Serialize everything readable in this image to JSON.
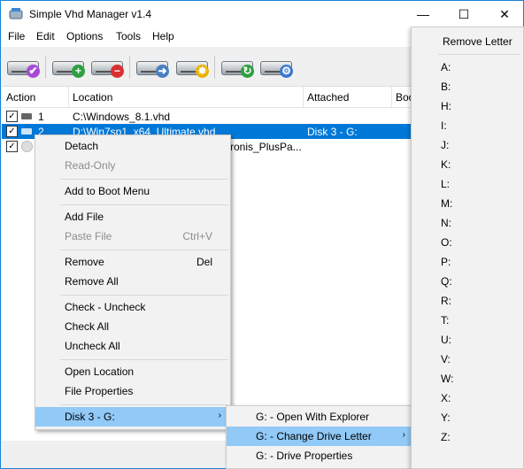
{
  "window": {
    "title": "Simple Vhd Manager v1.4",
    "minimize": "—",
    "maximize": "☐",
    "close": "✕"
  },
  "menubar": {
    "file": "File",
    "edit": "Edit",
    "options": "Options",
    "tools": "Tools",
    "help": "Help"
  },
  "toolbar": {
    "buttons": [
      {
        "name": "attach-button",
        "badge": "✔",
        "color": "#a64ad6"
      },
      {
        "name": "add-button",
        "badge": "+",
        "color": "#2ea043"
      },
      {
        "name": "remove-button",
        "badge": "−",
        "color": "#d93030"
      },
      {
        "name": "open-location-button",
        "badge": "➜",
        "color": "#4a7fc1"
      },
      {
        "name": "properties-button",
        "badge": "✸",
        "color": "#e8b400"
      },
      {
        "name": "refresh-button",
        "badge": "↻",
        "color": "#2ea043"
      },
      {
        "name": "settings-button",
        "badge": "⚙",
        "color": "#3a78d0"
      }
    ]
  },
  "list": {
    "columns": [
      "Action",
      "Location",
      "Attached",
      "Boo"
    ],
    "rows": [
      {
        "check": "✓",
        "num": "1",
        "location": "C:\\Windows_8.1.vhd",
        "attached": ""
      },
      {
        "check": "✓",
        "num": "2",
        "location": "D:\\Win7sp1_x64_Ultimate.vhd",
        "attached": "Disk 3  -  G:"
      },
      {
        "check": "✓",
        "num": "",
        "location": "ronis_PlusPa...",
        "attached": ""
      }
    ]
  },
  "context_menu": {
    "detach": "Detach",
    "read_only": "Read-Only",
    "add_boot": "Add to Boot Menu",
    "add_file": "Add File",
    "paste_file": "Paste File",
    "paste_shortcut": "Ctrl+V",
    "remove": "Remove",
    "remove_shortcut": "Del",
    "remove_all": "Remove All",
    "check_uncheck": "Check - Uncheck",
    "check_all": "Check All",
    "uncheck_all": "Uncheck All",
    "open_location": "Open Location",
    "file_properties": "File Properties",
    "disk": "Disk 3  -  G:",
    "arrow": "›"
  },
  "submenu": {
    "open_explorer": "G: - Open With Explorer",
    "change_letter": "G: - Change Drive Letter",
    "drive_properties": "G: - Drive Properties",
    "arrow": "›"
  },
  "letter_menu": {
    "title": "Remove Letter",
    "letters": [
      "A:",
      "B:",
      "H:",
      "I:",
      "J:",
      "K:",
      "L:",
      "M:",
      "N:",
      "O:",
      "P:",
      "Q:",
      "R:",
      "T:",
      "U:",
      "V:",
      "W:",
      "X:",
      "Y:",
      "Z:"
    ]
  },
  "colors": {
    "selection": "#0078d7",
    "hover": "#91c9f7",
    "accent_border": "#1883d7"
  }
}
